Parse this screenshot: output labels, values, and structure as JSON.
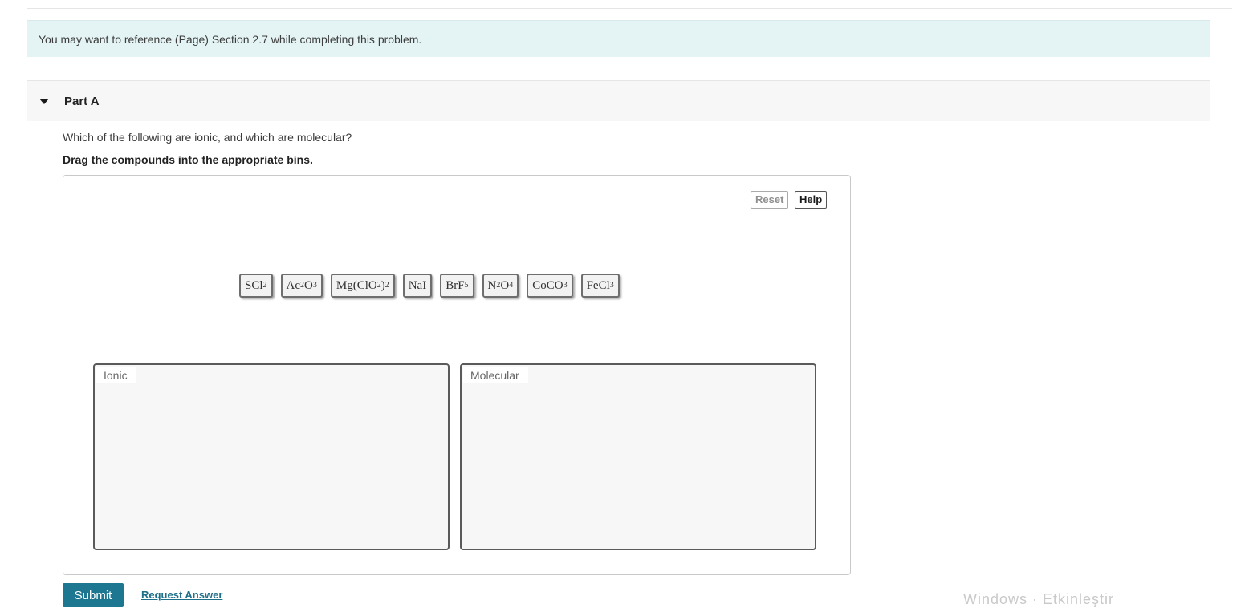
{
  "banner": {
    "text": "You may want to reference (Page) Section 2.7 while completing this problem."
  },
  "part": {
    "title": "Part A",
    "toggle_icon": "caret-down-icon"
  },
  "question": "Which of the following are ionic, and which are molecular?",
  "instruction": "Drag the compounds into the appropriate bins.",
  "toolbar": {
    "reset_label": "Reset",
    "help_label": "Help"
  },
  "compounds": [
    {
      "id": "scl2",
      "text": "SCl2",
      "parts": [
        [
          "SCl",
          ""
        ],
        [
          "2",
          "sub"
        ]
      ]
    },
    {
      "id": "ac2o3",
      "text": "Ac2O3",
      "parts": [
        [
          "Ac",
          ""
        ],
        [
          "2",
          "sub"
        ],
        [
          "O",
          ""
        ],
        [
          "3",
          "sub"
        ]
      ]
    },
    {
      "id": "mgclo22",
      "text": "Mg(ClO2)2",
      "parts": [
        [
          "Mg(ClO",
          ""
        ],
        [
          "2",
          "sub"
        ],
        [
          ")",
          ""
        ],
        [
          "2",
          "sub"
        ]
      ]
    },
    {
      "id": "nai",
      "text": "NaI",
      "parts": [
        [
          "NaI",
          ""
        ]
      ]
    },
    {
      "id": "brf5",
      "text": "BrF5",
      "parts": [
        [
          "BrF",
          ""
        ],
        [
          "5",
          "sub"
        ]
      ]
    },
    {
      "id": "n2o4",
      "text": "N2O4",
      "parts": [
        [
          "N",
          ""
        ],
        [
          "2",
          "sub"
        ],
        [
          "O",
          ""
        ],
        [
          "4",
          "sub"
        ]
      ]
    },
    {
      "id": "coco3",
      "text": "CoCO3",
      "parts": [
        [
          "CoCO",
          ""
        ],
        [
          "3",
          "sub"
        ]
      ]
    },
    {
      "id": "fecl3",
      "text": "FeCl3",
      "parts": [
        [
          "FeCl",
          ""
        ],
        [
          "3",
          "sub"
        ]
      ]
    }
  ],
  "bins": {
    "ionic_label": "Ionic",
    "molecular_label": "Molecular"
  },
  "actions": {
    "submit_label": "Submit",
    "request_answer_label": "Request Answer"
  },
  "watermark": "Windows · Etkinleştir",
  "colors": {
    "banner_bg": "#e4f3f4",
    "submit_bg": "#1d7790",
    "link": "#1d6f8a"
  }
}
